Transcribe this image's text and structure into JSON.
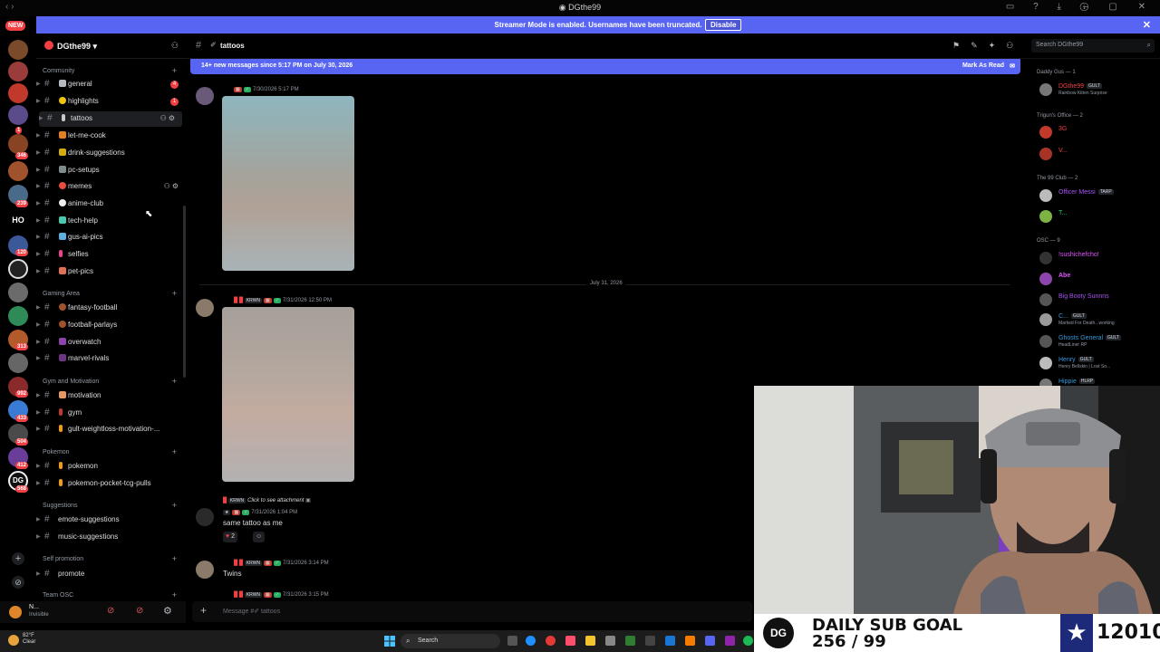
{
  "window": {
    "title": "DGthe99"
  },
  "banner": {
    "message": "Streamer Mode is enabled. Usernames have been truncated.",
    "disable": "Disable"
  },
  "rail": {
    "new_badge": "NEW",
    "badges": [
      "1",
      "346",
      "239",
      "120",
      "2",
      "313",
      "21",
      "992",
      "433",
      "504",
      "412",
      "568"
    ],
    "home_label": "HO"
  },
  "server": {
    "name": "DGthe99"
  },
  "sidebar": {
    "categories": [
      "Community",
      "Gaming Area",
      "Gym and Motivation",
      "Pokemon",
      "Suggestions",
      "Self promotion",
      "Team OSC"
    ],
    "community": [
      {
        "label": "general",
        "mention": "4"
      },
      {
        "label": "highlights",
        "mention": "1"
      },
      {
        "label": "tattoos"
      },
      {
        "label": "let-me-cook"
      },
      {
        "label": "drink-suggestions"
      },
      {
        "label": "pc-setups"
      },
      {
        "label": "memes"
      },
      {
        "label": "anime-club"
      },
      {
        "label": "tech-help"
      },
      {
        "label": "gus-ai-pics"
      },
      {
        "label": "selfies"
      },
      {
        "label": "pet-pics"
      }
    ],
    "gaming": [
      {
        "label": "fantasy-football"
      },
      {
        "label": "football-parlays"
      },
      {
        "label": "overwatch"
      },
      {
        "label": "marvel-rivals"
      }
    ],
    "gym": [
      {
        "label": "motivation"
      },
      {
        "label": "gym"
      },
      {
        "label": "gult-weightloss-motivation-..."
      }
    ],
    "pokemon": [
      {
        "label": "pokemon"
      },
      {
        "label": "pokemon-pocket-tcg-pulls"
      }
    ],
    "suggestions": [
      {
        "label": "emote-suggestions"
      },
      {
        "label": "music-suggestions"
      }
    ],
    "selfpromo": [
      {
        "label": "promote"
      }
    ]
  },
  "user": {
    "name": "N...",
    "status": "Invisible"
  },
  "chat": {
    "channel": "tattoos",
    "new_messages": "14+ new messages since 5:17 PM on July 30, 2026",
    "mark_read": "Mark As Read",
    "date_divider": "July 31, 2026",
    "msg1_time": "7/30/2026 5:17 PM",
    "msg2_time": "7/31/2026 12:50 PM",
    "msg3_time": "7/31/2026 1:04 PM",
    "msg4_time": "7/31/2026 3:14 PM",
    "msg5_time": "7/31/2026 3:15 PM",
    "tag_krwn": "KRWN",
    "click_attachment": "Click to see attachment",
    "msg3_text": "same tattoo as me",
    "reaction_count": "2",
    "msg4_text": "Twins",
    "composer_placeholder": "Message #✐ tattoos"
  },
  "search": {
    "placeholder": "Search DGthe99"
  },
  "members": {
    "groups": [
      {
        "title": "Daddy Gus — 1"
      },
      {
        "title": "Trigun's Office — 2"
      },
      {
        "title": "The 99 Club — 2"
      },
      {
        "title": "OSC — 9"
      }
    ],
    "list": [
      {
        "name": "DGthe99",
        "tag": "GULT",
        "sub": "Rainbow Kitten Surprise",
        "color": "#ed4245"
      },
      {
        "name": "3G",
        "color": "#ed4245"
      },
      {
        "name": "V...",
        "color": "#ed4245"
      },
      {
        "name": "Officer Messi",
        "tag": "TARP",
        "color": "#a855f7"
      },
      {
        "name": "T...",
        "color": "#2ecc71"
      },
      {
        "name": "!sushichefcho!",
        "color": "#e056fd"
      },
      {
        "name": "Abe",
        "color": "#e056fd"
      },
      {
        "name": "Big Booty Sunnns",
        "color": "#a855f7"
      },
      {
        "name": "C...",
        "tag": "GULT",
        "sub": "Marked For Death...working",
        "color": "#3498db"
      },
      {
        "name": "Ghosts General",
        "tag": "GULT",
        "sub": "HeadLiner RP",
        "color": "#3498db"
      },
      {
        "name": "Henry",
        "tag": "GULT",
        "sub": "Henry Bellskin | Lost So...",
        "color": "#3498db"
      },
      {
        "name": "Hippie",
        "tag": "HLRP",
        "color": "#3498db"
      }
    ]
  },
  "subgoal": {
    "title": "DAILY SUB GOAL",
    "progress": "256 / 99",
    "total": "12010",
    "logo": "DG"
  },
  "taskbar": {
    "temp": "82°F",
    "weather": "Clear",
    "search": "Search"
  },
  "colors": {
    "accent": "#5865f2",
    "mention": "#f23f43",
    "bg": "#000000"
  }
}
